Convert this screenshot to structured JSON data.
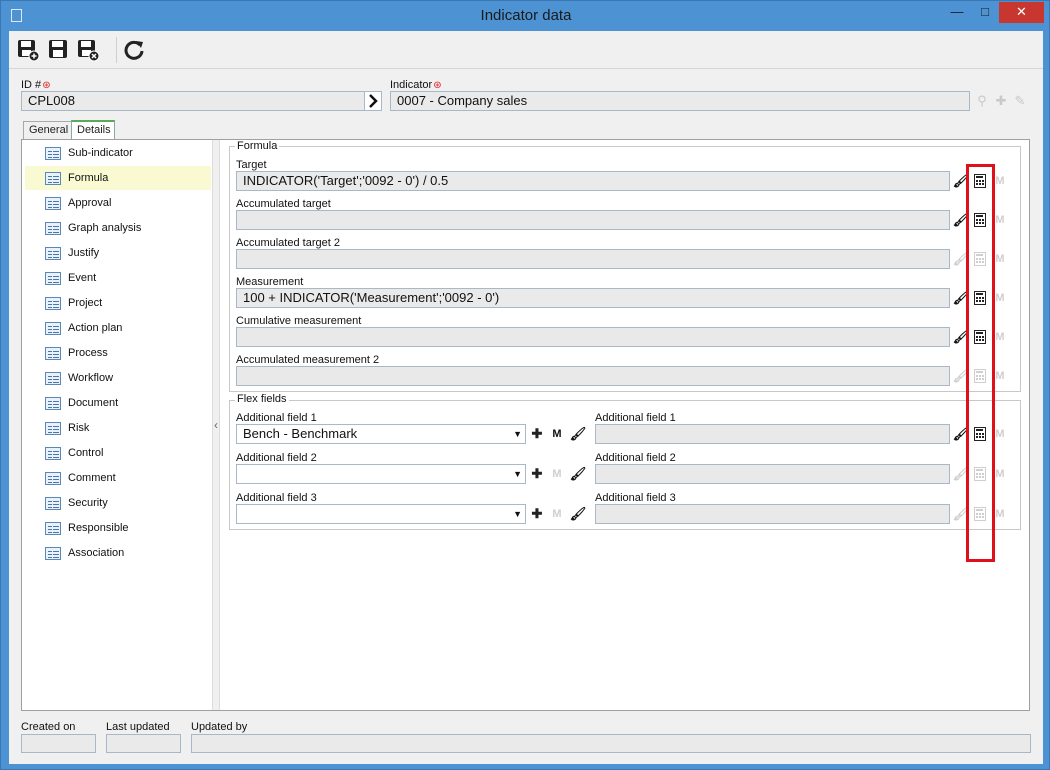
{
  "window": {
    "title": "Indicator data",
    "minimize": "—",
    "maximize": "□",
    "close": "✕"
  },
  "toolbar": {
    "save_new": "save-new",
    "save": "save",
    "save_close": "save-close",
    "refresh": "refresh"
  },
  "header": {
    "id_label": "ID #",
    "id_value": "CPL008",
    "indicator_label": "Indicator",
    "indicator_value": "0007 - Company sales"
  },
  "tabs": [
    {
      "label": "General"
    },
    {
      "label": "Details"
    }
  ],
  "nav": {
    "items": [
      {
        "label": "Sub-indicator"
      },
      {
        "label": "Formula"
      },
      {
        "label": "Approval"
      },
      {
        "label": "Graph analysis"
      },
      {
        "label": "Justify"
      },
      {
        "label": "Event"
      },
      {
        "label": "Project"
      },
      {
        "label": "Action plan"
      },
      {
        "label": "Process"
      },
      {
        "label": "Workflow"
      },
      {
        "label": "Document"
      },
      {
        "label": "Risk"
      },
      {
        "label": "Control"
      },
      {
        "label": "Comment"
      },
      {
        "label": "Security"
      },
      {
        "label": "Responsible"
      },
      {
        "label": "Association"
      }
    ],
    "selected": "Formula",
    "collapse_glyph": "‹"
  },
  "formula": {
    "legend": "Formula",
    "fields": [
      {
        "label": "Target",
        "value": "INDICATOR('Target';'0092 - 0') / 0.5"
      },
      {
        "label": "Accumulated target",
        "value": ""
      },
      {
        "label": "Accumulated target 2",
        "value": ""
      },
      {
        "label": "Measurement",
        "value": "100 + INDICATOR('Measurement';'0092 - 0')"
      },
      {
        "label": "Cumulative measurement",
        "value": ""
      },
      {
        "label": "Accumulated measurement 2",
        "value": ""
      }
    ]
  },
  "flex": {
    "legend": "Flex fields",
    "left": [
      {
        "label": "Additional field 1",
        "value": "Bench - Benchmark"
      },
      {
        "label": "Additional field 2",
        "value": ""
      },
      {
        "label": "Additional field 3",
        "value": ""
      }
    ],
    "right": [
      {
        "label": "Additional field 1",
        "value": ""
      },
      {
        "label": "Additional field 2",
        "value": ""
      },
      {
        "label": "Additional field 3",
        "value": ""
      }
    ]
  },
  "footer": {
    "created_on": "Created on",
    "last_updated": "Last updated",
    "updated_by": "Updated by"
  },
  "colors": {
    "highlight": "#e0101a",
    "titlebar": "#4d93d3",
    "selected_row": "#fafad2"
  }
}
